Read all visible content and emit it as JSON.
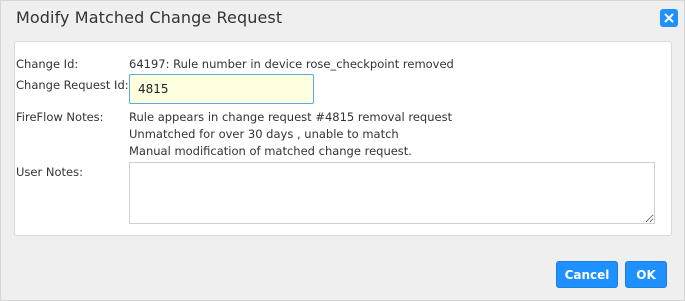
{
  "dialog": {
    "title": "Modify Matched Change Request",
    "close_icon": "close-icon"
  },
  "form": {
    "change_id": {
      "label": "Change Id:",
      "value": "64197: Rule number in device rose_checkpoint removed"
    },
    "change_request_id": {
      "label": "Change Request Id:",
      "value": "4815"
    },
    "fireflow_notes": {
      "label": "FireFlow Notes:",
      "lines": [
        "Rule appears in change request #4815 removal request",
        "Unmatched for over 30 days , unable to match",
        "Manual modification of matched change request."
      ]
    },
    "user_notes": {
      "label": "User Notes:",
      "value": ""
    }
  },
  "buttons": {
    "cancel_label": "Cancel",
    "ok_label": "OK"
  },
  "colors": {
    "accent": "#1e90ff",
    "input_highlight": "#ffffe0"
  }
}
